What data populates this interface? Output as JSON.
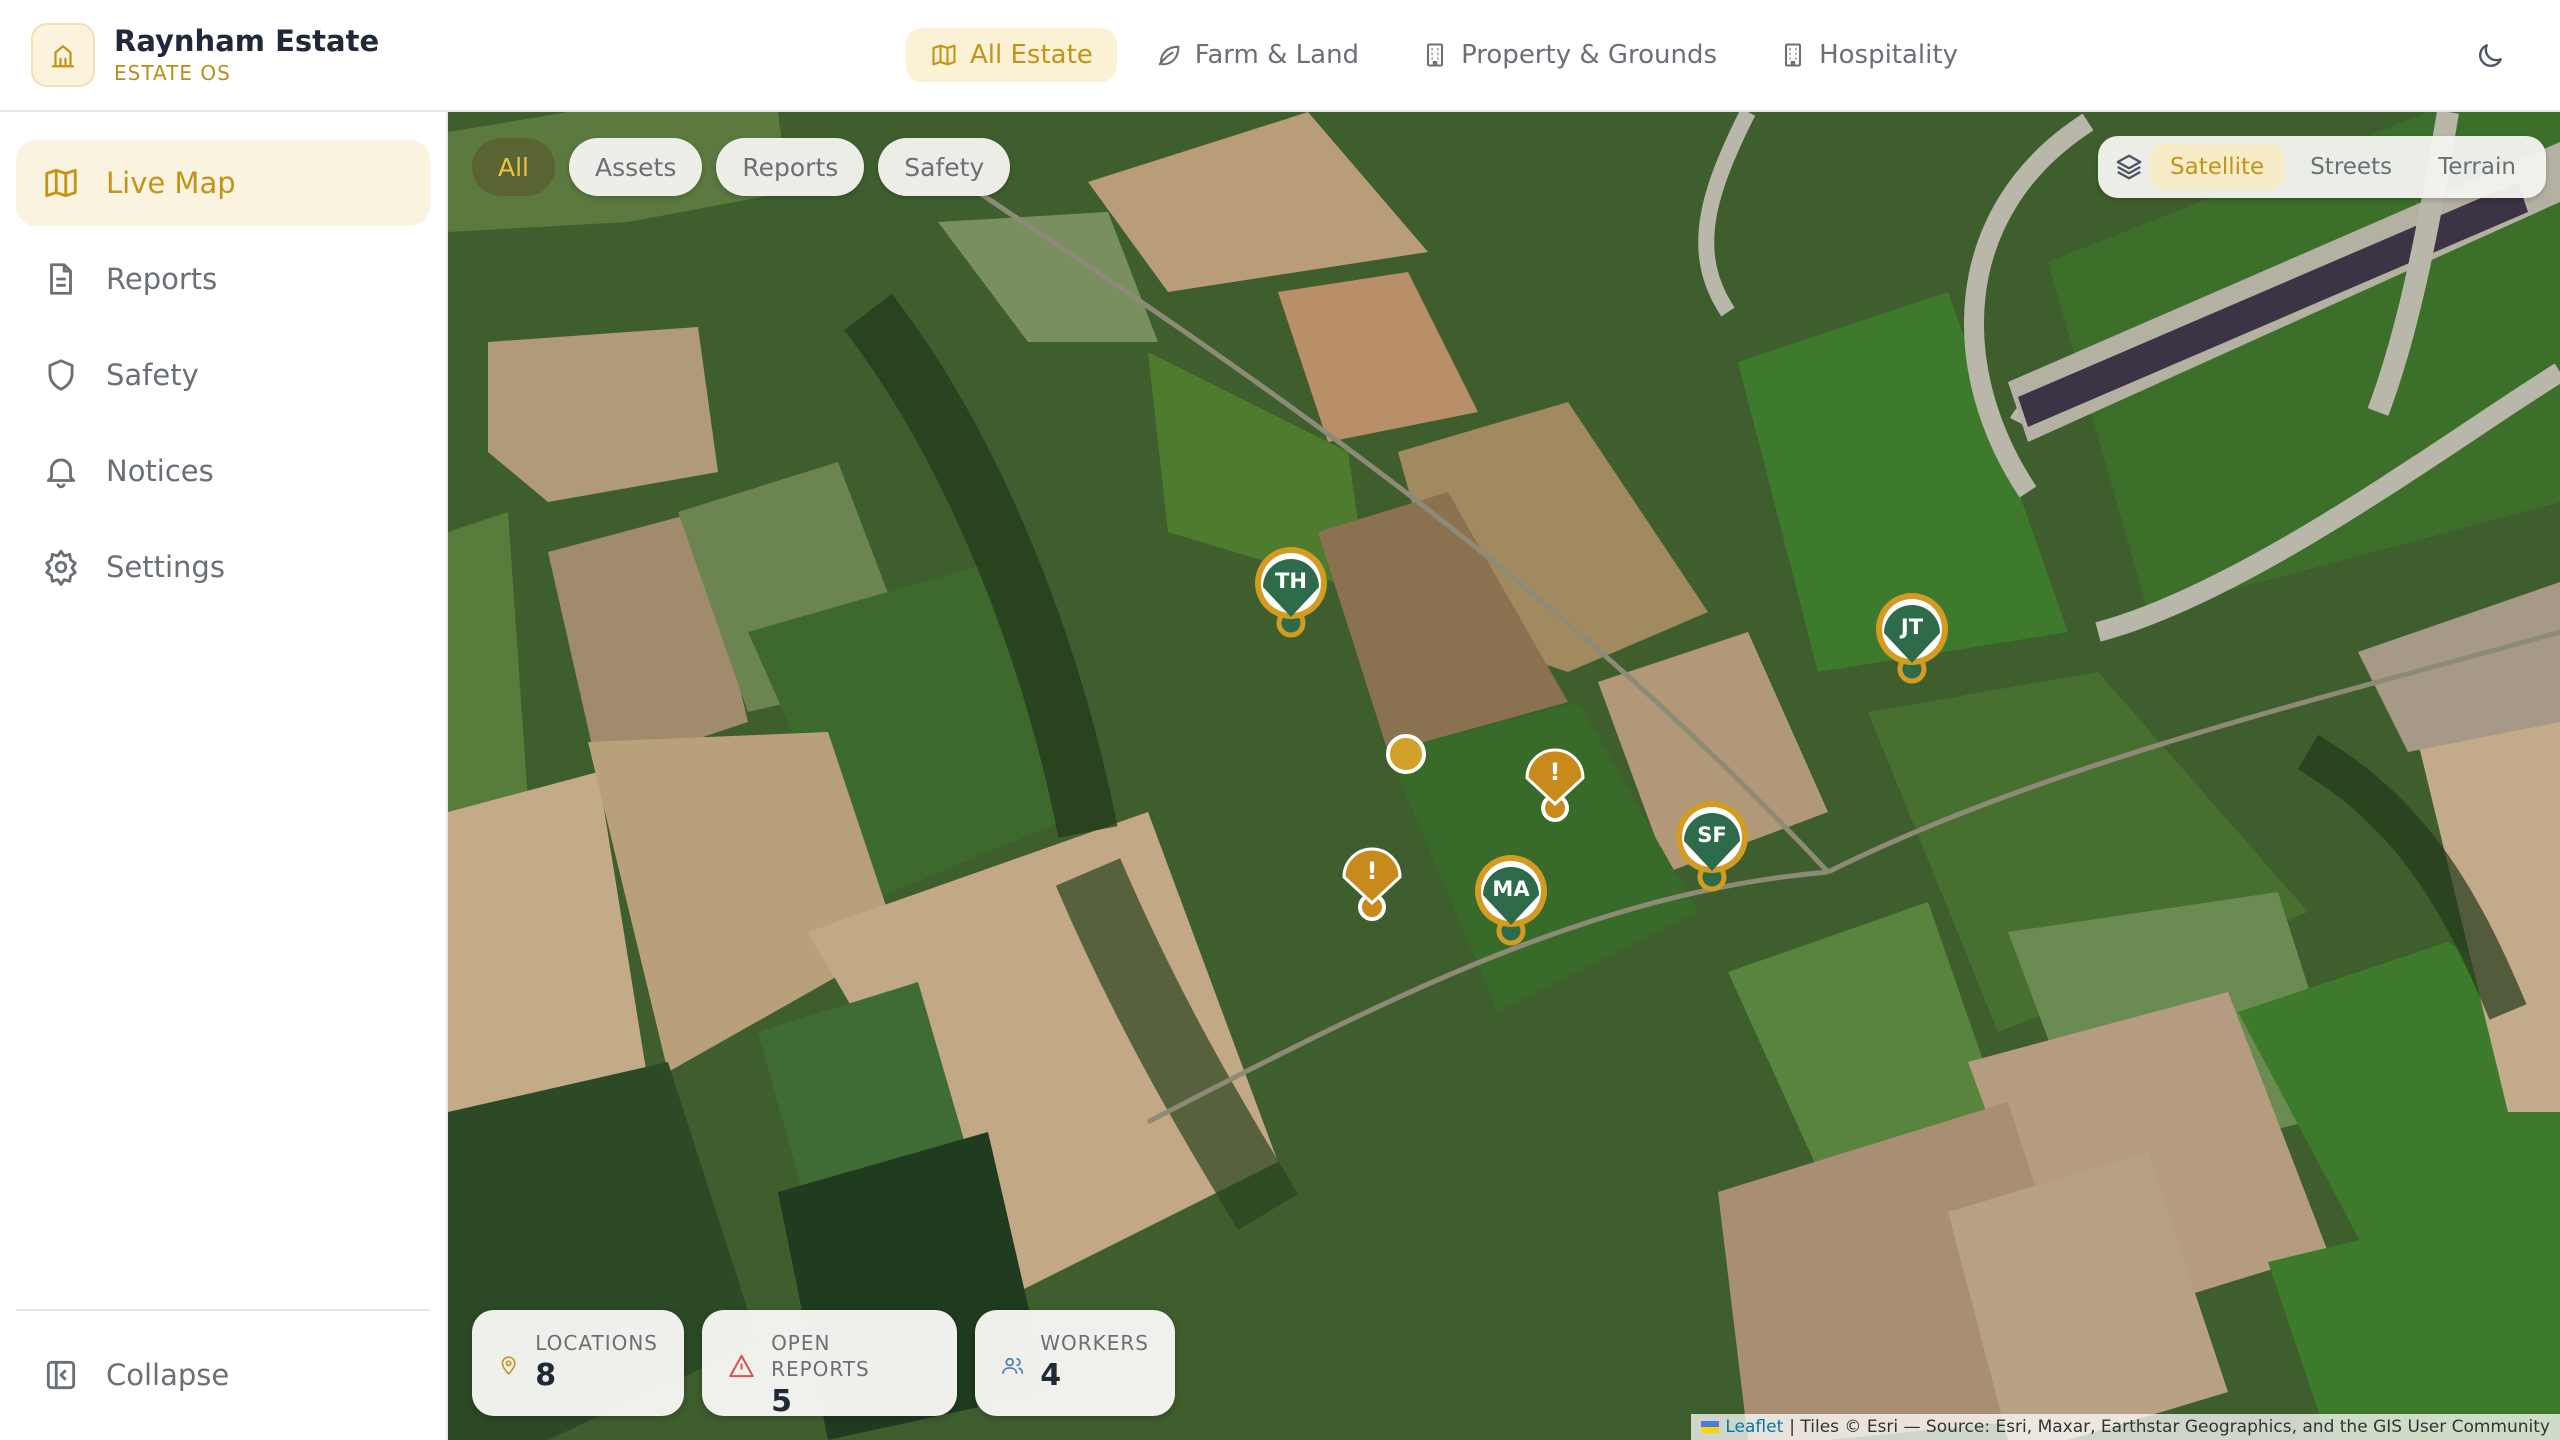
{
  "brand": {
    "title": "Raynham Estate",
    "subtitle": "ESTATE OS"
  },
  "nav": {
    "items": [
      {
        "label": "All Estate",
        "icon": "map-icon",
        "active": true
      },
      {
        "label": "Farm & Land",
        "icon": "leaf-icon",
        "active": false
      },
      {
        "label": "Property & Grounds",
        "icon": "building-icon",
        "active": false
      },
      {
        "label": "Hospitality",
        "icon": "building-icon",
        "active": false
      }
    ]
  },
  "sidebar": {
    "items": [
      {
        "label": "Live Map",
        "icon": "map-icon",
        "active": true
      },
      {
        "label": "Reports",
        "icon": "document-icon",
        "active": false
      },
      {
        "label": "Safety",
        "icon": "shield-icon",
        "active": false
      },
      {
        "label": "Notices",
        "icon": "bell-icon",
        "active": false
      },
      {
        "label": "Settings",
        "icon": "gear-icon",
        "active": false
      }
    ],
    "collapse_label": "Collapse"
  },
  "map": {
    "filters": [
      "All",
      "Assets",
      "Reports",
      "Safety"
    ],
    "active_filter": "All",
    "layers": [
      "Satellite",
      "Streets",
      "Terrain"
    ],
    "active_layer": "Satellite",
    "markers": {
      "workers": [
        "TH",
        "JT",
        "SF",
        "MA"
      ],
      "alert_symbol": "!"
    },
    "stats": [
      {
        "label": "LOCATIONS",
        "value": "8",
        "icon": "pin-icon"
      },
      {
        "label": "OPEN REPORTS",
        "value": "5",
        "icon": "warning-icon"
      },
      {
        "label": "WORKERS",
        "value": "4",
        "icon": "users-icon"
      }
    ],
    "attribution": {
      "leaflet": "Leaflet",
      "tiles": "| Tiles © Esri — Source: Esri, Maxar, Earthstar Geographics, and the GIS User Community"
    }
  },
  "colors": {
    "accent": "#c49419",
    "worker": "#2e6b4a",
    "alert": "#c98a1c"
  }
}
